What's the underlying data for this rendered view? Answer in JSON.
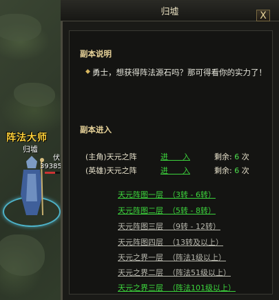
{
  "npc": {
    "title": "阵法大师",
    "name": "归墟",
    "hp_text": "39385",
    "side_label": "伏",
    "hp_fraction": 0.7
  },
  "window": {
    "title": "归墟",
    "close_label": "X"
  },
  "description": {
    "heading": "副本说明",
    "text": "勇士，想获得阵法源石吗？那可得看你的实力了！"
  },
  "entry": {
    "heading": "副本进入",
    "rows": [
      {
        "label": "(主角)天元之阵",
        "enter": "进      入",
        "remain_prefix": "剩余:",
        "count": "6",
        "unit": "次"
      },
      {
        "label": "(英雄)天元之阵",
        "enter": "进      入",
        "remain_prefix": "剩余:",
        "count": "6",
        "unit": "次"
      }
    ]
  },
  "levels": [
    {
      "label": "天元阵图一层  （3转 - 6转）",
      "enabled": true
    },
    {
      "label": "天元阵图二层  （5转 - 8转）",
      "enabled": true
    },
    {
      "label": "天元阵图三层  （9转 - 12转）",
      "enabled": false
    },
    {
      "label": "天元阵图四层  （13转及以上）",
      "enabled": false
    },
    {
      "label": "天元之界一层  （阵法1级以上）",
      "enabled": false
    },
    {
      "label": "天元之界二层  （阵法51级以上）",
      "enabled": false
    },
    {
      "label": "天元之界三层  （阵法101级以上）",
      "enabled": true
    }
  ],
  "colors": {
    "enabled_link": "#3dd63d",
    "disabled_link": "#b8b8ae",
    "heading": "#e9d49a",
    "npc_title": "#ffd23a"
  }
}
